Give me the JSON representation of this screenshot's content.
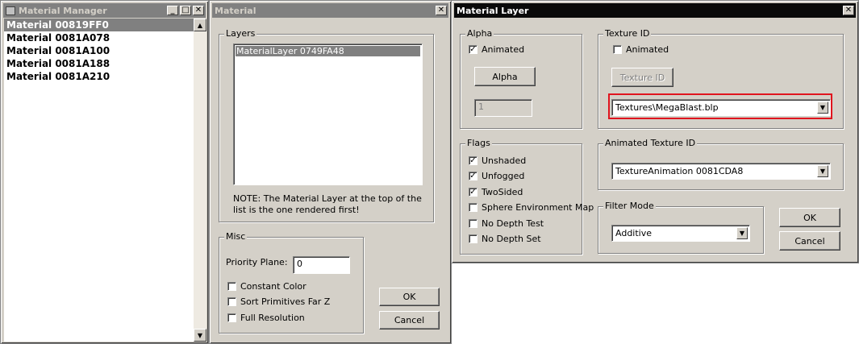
{
  "material_manager": {
    "title": "Material Manager",
    "items": [
      "Material 00819FF0",
      "Material 0081A078",
      "Material 0081A100",
      "Material 0081A188",
      "Material 0081A210"
    ]
  },
  "material": {
    "title": "Material",
    "layers_label": "Layers",
    "layers": [
      "MaterialLayer 0749FA48"
    ],
    "note": "NOTE: The Material Layer at the top of the list is the one rendered first!",
    "misc_label": "Misc",
    "priority_label": "Priority Plane:",
    "priority_value": "0",
    "constant_color": "Constant Color",
    "sort_primitives": "Sort Primitives Far Z",
    "full_resolution": "Full Resolution",
    "ok": "OK",
    "cancel": "Cancel"
  },
  "layer": {
    "title": "Material Layer",
    "alpha_label": "Alpha",
    "alpha_animated": "Animated",
    "alpha_button": "Alpha",
    "alpha_value": "1",
    "texture_label": "Texture ID",
    "texture_animated": "Animated",
    "texture_button": "Texture ID",
    "texture_value": "Textures\\MegaBlast.blp",
    "flags_label": "Flags",
    "flags": {
      "unshaded": "Unshaded",
      "unfogged": "Unfogged",
      "twosided": "TwoSided",
      "sphere_env": "Sphere Environment Map",
      "no_depth_test": "No Depth Test",
      "no_depth_set": "No Depth Set"
    },
    "anim_texture_label": "Animated Texture ID",
    "anim_texture_value": "TextureAnimation 0081CDA8",
    "filter_label": "Filter Mode",
    "filter_value": "Additive",
    "ok": "OK",
    "cancel": "Cancel"
  },
  "colors": {
    "highlight_box": "#e0141e"
  }
}
